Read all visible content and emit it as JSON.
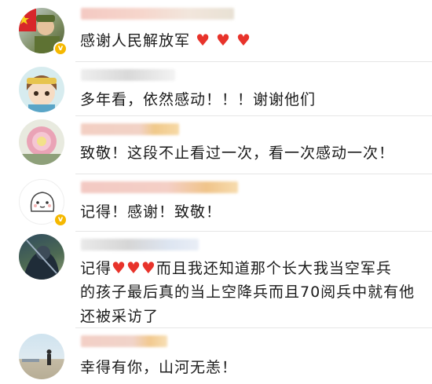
{
  "comments": [
    {
      "text": "感谢人民解放军",
      "suffix": "",
      "hearts": 3
    },
    {
      "text": "多年看，依然感动！！！谢谢他们"
    },
    {
      "text": "致敬！这段不止看过一次，看一次感动一次！"
    },
    {
      "text": "记得！感谢！致敬！"
    },
    {
      "prefix": "记得",
      "hearts": 3,
      "line1_rest": "而且我还知道那个长大我当空军兵",
      "line2": "的孩子最后真的当上空降兵而且70阅兵中就有他",
      "line3": "还被采访了"
    },
    {
      "text": "幸得有你，山河无恙！"
    }
  ],
  "icons": {
    "heart": "♥",
    "verified_badge": "v"
  },
  "colors": {
    "heart": "#e8332b",
    "badge": "#f5b800"
  }
}
